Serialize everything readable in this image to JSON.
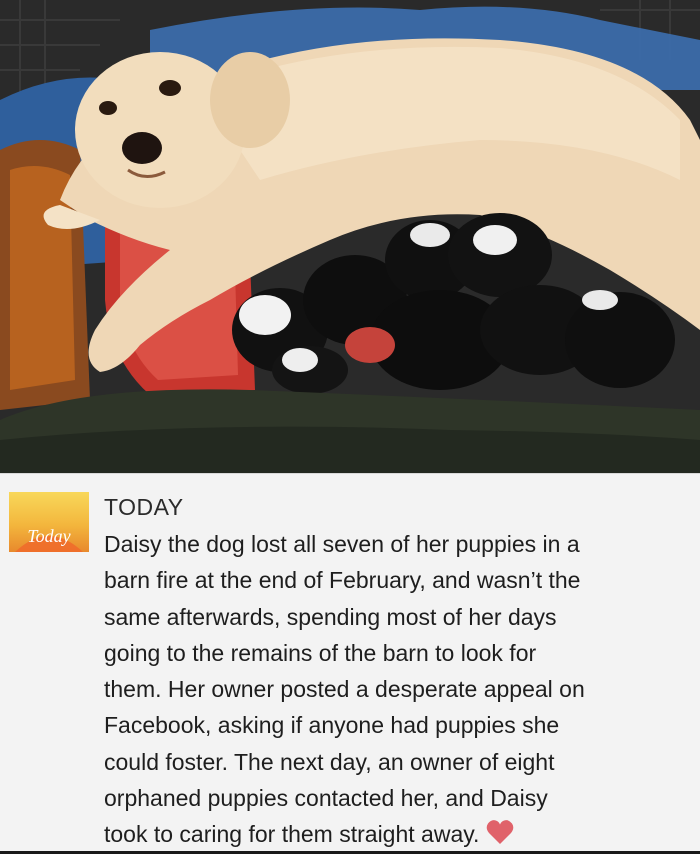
{
  "photo": {
    "subject": "dog-with-puppies-photo"
  },
  "post": {
    "source_logo_text": "Today",
    "source_name": "TODAY",
    "body_lines": [
      "Daisy the dog lost all seven of her puppies in a",
      "barn fire at the end of February, and wasn’t the",
      "same afterwards, spending most of her days",
      "going to the remains of the barn to look for",
      "them. Her owner posted a desperate appeal on",
      "Facebook, asking if anyone had puppies she",
      "could foster. The next day, an owner of eight",
      "orphaned puppies contacted her, and Daisy",
      "took to caring for them straight away."
    ],
    "heart_icon": "heart-icon",
    "heart_color": "#e0626a"
  },
  "colors": {
    "logo_top": "#f6c940",
    "logo_bottom": "#e8892c",
    "logo_text": "#ffffff"
  }
}
